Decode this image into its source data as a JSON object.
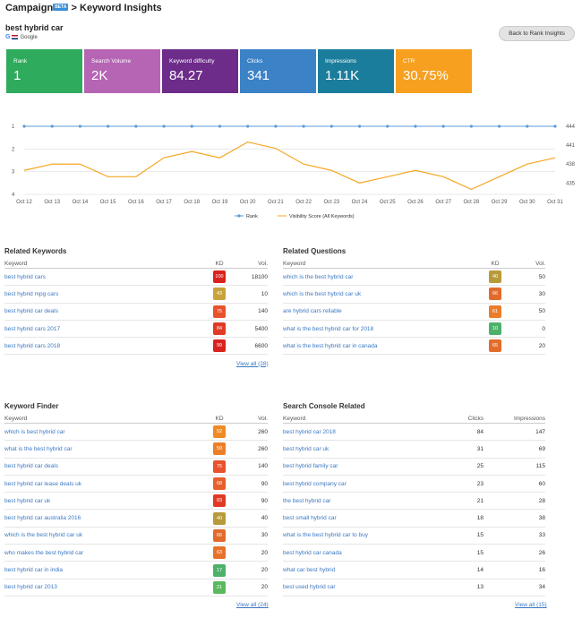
{
  "header": {
    "brand": "Campaign",
    "beta": "BETA",
    "separator": ">",
    "page_title": "Keyword Insights",
    "keyword": "best hybrid car",
    "engine": "Google",
    "back_label": "Back to Rank Insights"
  },
  "metrics": [
    {
      "label": "Rank",
      "value": "1",
      "color": "#2eab5c"
    },
    {
      "label": "Search Volume",
      "value": "2K",
      "color": "#b565b4"
    },
    {
      "label": "Keyword difficulty",
      "value": "84.27",
      "color": "#6d2b8a"
    },
    {
      "label": "Clicks",
      "value": "341",
      "color": "#3b82c6"
    },
    {
      "label": "Impressions",
      "value": "1.11K",
      "color": "#1b7d9c"
    },
    {
      "label": "CTR",
      "value": "30.75%",
      "color": "#f7a020"
    }
  ],
  "chart_data": {
    "type": "line",
    "x": [
      "Oct 12",
      "Oct 13",
      "Oct 14",
      "Oct 15",
      "Oct 16",
      "Oct 17",
      "Oct 18",
      "Oct 19",
      "Oct 20",
      "Oct 21",
      "Oct 22",
      "Oct 23",
      "Oct 24",
      "Oct 25",
      "Oct 26",
      "Oct 27",
      "Oct 28",
      "Oct 29",
      "Oct 30",
      "Oct 31"
    ],
    "left_ticks": [
      "1",
      "2",
      "3",
      "4"
    ],
    "right_ticks": [
      "444",
      "441",
      "438",
      "435"
    ],
    "left_range": [
      1,
      4
    ],
    "right_range": [
      433.2,
      444
    ],
    "series": [
      {
        "name": "Rank",
        "axis": "left",
        "color": "#5b9bd5",
        "values": [
          1,
          1,
          1,
          1,
          1,
          1,
          1,
          1,
          1,
          1,
          1,
          1,
          1,
          1,
          1,
          1,
          1,
          1,
          1,
          1
        ]
      },
      {
        "name": "Visibility Score (All Keywords)",
        "axis": "right",
        "color": "#f5a623",
        "values": [
          437,
          438,
          438,
          436,
          436,
          439,
          440,
          439,
          441.5,
          440.5,
          438,
          437,
          435,
          436,
          437,
          436,
          434,
          436,
          438,
          439
        ]
      }
    ],
    "legend_position": "bottom-center",
    "grid": true
  },
  "related_keywords": {
    "title": "Related Keywords",
    "headers": [
      "Keyword",
      "KD",
      "Vol."
    ],
    "rows": [
      {
        "keyword": "best hybrid cars",
        "kd": "100",
        "kd_color": "#d9231e",
        "vol": "18100"
      },
      {
        "keyword": "best hybrid mpg cars",
        "kd": "43",
        "kd_color": "#c9a23c",
        "vol": "10"
      },
      {
        "keyword": "best hybrid car deals",
        "kd": "75",
        "kd_color": "#e8522c",
        "vol": "140"
      },
      {
        "keyword": "best hybrid cars 2017",
        "kd": "84",
        "kd_color": "#e03a24",
        "vol": "5400"
      },
      {
        "keyword": "best hybrid cars 2018",
        "kd": "99",
        "kd_color": "#d9231e",
        "vol": "6600"
      }
    ],
    "view_all": "View all (28)"
  },
  "related_questions": {
    "title": "Related Questions",
    "headers": [
      "Keyword",
      "KD",
      "Vol."
    ],
    "rows": [
      {
        "keyword": "which is the best hybrid car",
        "kd": "40",
        "kd_color": "#b89a3a",
        "vol": "50"
      },
      {
        "keyword": "which is the best hybrid car uk",
        "kd": "66",
        "kd_color": "#e26a2c",
        "vol": "30"
      },
      {
        "keyword": "are hybrid cars reliable",
        "kd": "61",
        "kd_color": "#ea7d2a",
        "vol": "50"
      },
      {
        "keyword": "what is the best hybrid car for 2018",
        "kd": "10",
        "kd_color": "#4cb26a",
        "vol": "0"
      },
      {
        "keyword": "what is the best hybrid car in canada",
        "kd": "65",
        "kd_color": "#e46c2b",
        "vol": "20"
      }
    ]
  },
  "keyword_finder": {
    "title": "Keyword Finder",
    "headers": [
      "Keyword",
      "KD",
      "Vol."
    ],
    "rows": [
      {
        "keyword": "which is best hybrid car",
        "kd": "52",
        "kd_color": "#ee8b25",
        "vol": "260"
      },
      {
        "keyword": "what is the best hybrid car",
        "kd": "59",
        "kd_color": "#ed7f27",
        "vol": "260"
      },
      {
        "keyword": "best hybrid car deals",
        "kd": "75",
        "kd_color": "#e8522c",
        "vol": "140"
      },
      {
        "keyword": "best hybrid car lease deals uk",
        "kd": "68",
        "kd_color": "#e7602b",
        "vol": "90"
      },
      {
        "keyword": "best hybrid car uk",
        "kd": "83",
        "kd_color": "#e03a24",
        "vol": "90"
      },
      {
        "keyword": "best hybrid car australia 2016",
        "kd": "40",
        "kd_color": "#b89a3a",
        "vol": "40"
      },
      {
        "keyword": "which is the best hybrid car uk",
        "kd": "66",
        "kd_color": "#e26a2c",
        "vol": "30"
      },
      {
        "keyword": "who makes the best hybrid car",
        "kd": "63",
        "kd_color": "#e8712a",
        "vol": "20"
      },
      {
        "keyword": "best hybrid car in india",
        "kd": "17",
        "kd_color": "#4cb26a",
        "vol": "20"
      },
      {
        "keyword": "best hybrid car 2013",
        "kd": "21",
        "kd_color": "#5cb85c",
        "vol": "20"
      }
    ],
    "view_all": "View all (24)"
  },
  "search_console": {
    "title": "Search Console Related",
    "headers": [
      "Keyword",
      "Clicks",
      "Impressions"
    ],
    "rows": [
      {
        "keyword": "best hybrid car 2018",
        "clicks": "84",
        "impressions": "147"
      },
      {
        "keyword": "best hybrid car uk",
        "clicks": "31",
        "impressions": "69"
      },
      {
        "keyword": "best hybrid family car",
        "clicks": "25",
        "impressions": "115"
      },
      {
        "keyword": "best hybrid company car",
        "clicks": "23",
        "impressions": "60"
      },
      {
        "keyword": "the best hybrid car",
        "clicks": "21",
        "impressions": "28"
      },
      {
        "keyword": "best small hybrid car",
        "clicks": "18",
        "impressions": "38"
      },
      {
        "keyword": "what is the best hybrid car to buy",
        "clicks": "15",
        "impressions": "33"
      },
      {
        "keyword": "best hybrid car canada",
        "clicks": "15",
        "impressions": "26"
      },
      {
        "keyword": "what car best hybrid",
        "clicks": "14",
        "impressions": "16"
      },
      {
        "keyword": "best used hybrid car",
        "clicks": "13",
        "impressions": "34"
      }
    ],
    "view_all": "View all (15)"
  }
}
